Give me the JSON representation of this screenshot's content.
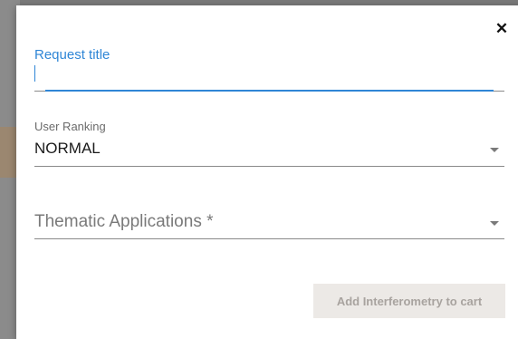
{
  "dialog": {
    "close_symbol": "✕",
    "close_icon": "close-icon"
  },
  "form": {
    "title_field": {
      "label": "Request title",
      "value": ""
    },
    "ranking_field": {
      "label": "User Ranking",
      "value": "NORMAL",
      "icon": "chevron-down-icon"
    },
    "thematic_field": {
      "placeholder": "Thematic Applications *",
      "icon": "chevron-down-icon"
    }
  },
  "actions": {
    "add_label": "Add Interferometry to cart"
  },
  "colors": {
    "accent": "#2f86d6",
    "disabled_button_bg": "#ece9e6",
    "disabled_button_text": "#a8a39f"
  }
}
